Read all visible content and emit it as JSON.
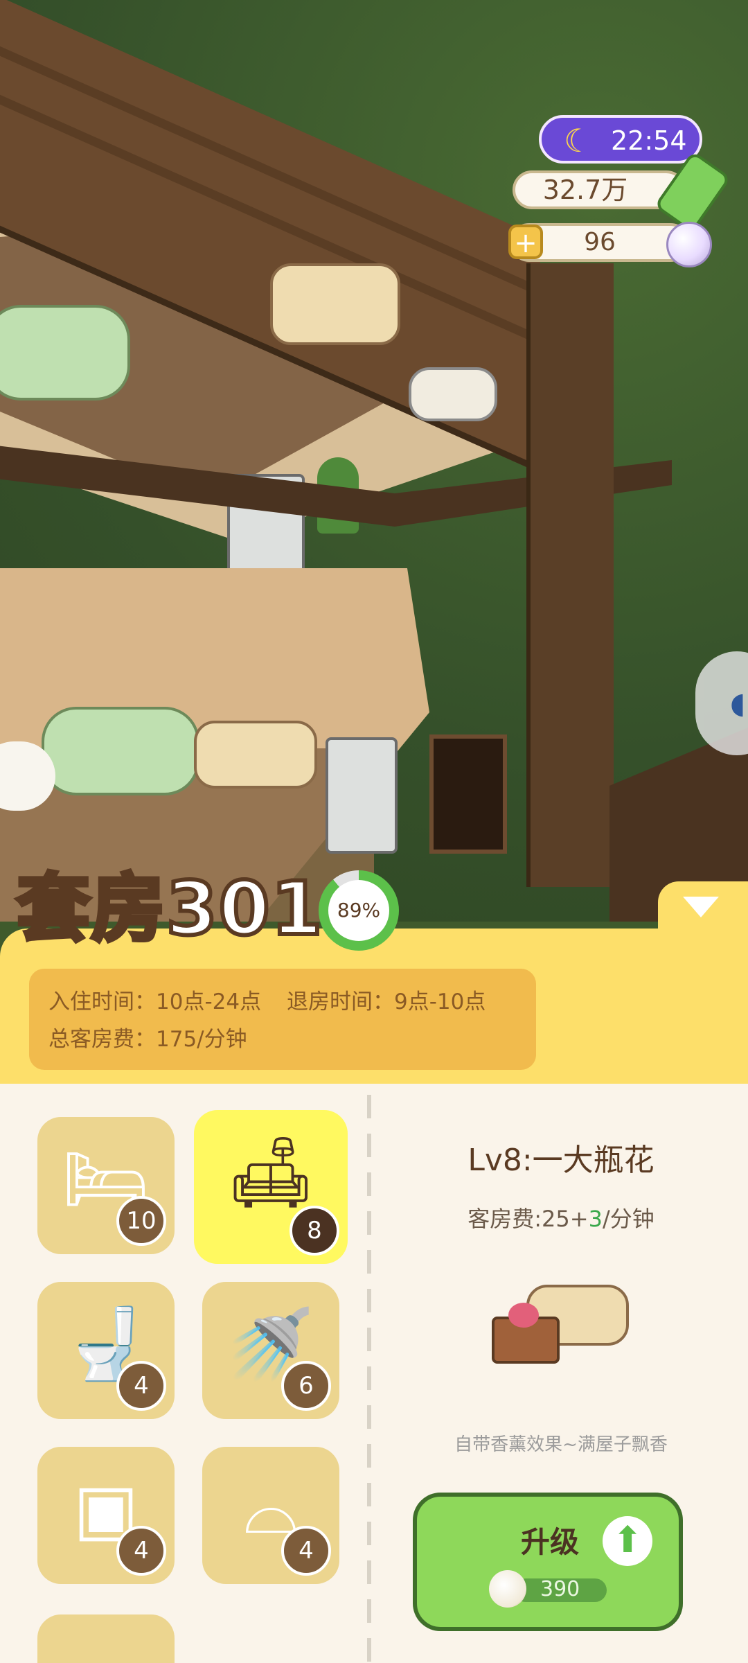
{
  "hud": {
    "time": "22:54",
    "currency": "32.7万",
    "pearls": "96",
    "plus_symbol": "+",
    "moon_icon": "moon-icon"
  },
  "room": {
    "title": "套房301",
    "occupancy_percent": 89,
    "occupancy_label": "89%",
    "checkin_label": "入住时间：10点-24点",
    "checkout_label": "退房时间：9点-10点",
    "total_fee_label": "总客房费：175/分钟"
  },
  "categories": [
    {
      "icon": "bed-icon",
      "count": "10",
      "active": false
    },
    {
      "icon": "sofa-flower-icon",
      "count": "8",
      "active": true
    },
    {
      "icon": "toilet-icon",
      "count": "4",
      "active": false
    },
    {
      "icon": "shower-icon",
      "count": "6",
      "active": false
    },
    {
      "icon": "nightstand-icon",
      "count": "4",
      "active": false
    },
    {
      "icon": "sink-icon",
      "count": "4",
      "active": false
    }
  ],
  "detail": {
    "level_title": "Lv8:一大瓶花",
    "fee_prefix": "客房费:25+",
    "fee_bonus": "3",
    "fee_suffix": "/分钟",
    "description": "自带香薰效果~满屋子飘香",
    "upgrade_label": "升级",
    "upgrade_cost": "390"
  },
  "colors": {
    "panel_yellow": "#fddf6a",
    "panel_cream": "#faf4ea",
    "active_tab": "#fff960",
    "upgrade_green": "#8ed85a",
    "progress_green": "#5cc04a",
    "time_purple": "#6a49d6"
  }
}
